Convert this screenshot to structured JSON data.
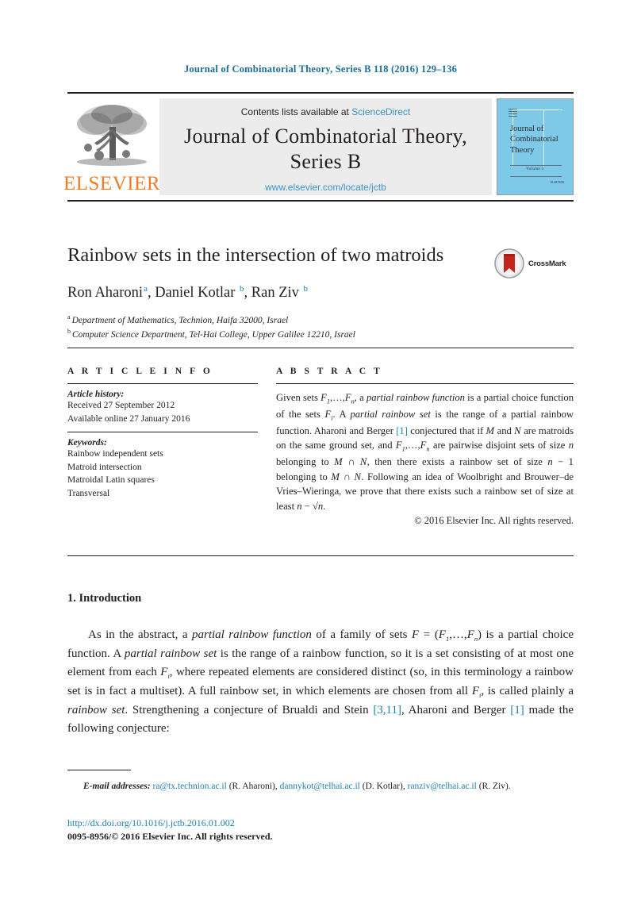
{
  "running_head": "Journal of Combinatorial Theory, Series B 118 (2016) 129–136",
  "masthead": {
    "publisher_logo_text": "ELSEVIER",
    "contents_prefix": "Contents lists available at",
    "contents_link": "ScienceDirect",
    "journal_title_line1": "Journal of Combinatorial Theory,",
    "journal_title_line2": "Series B",
    "journal_url": "www.elsevier.com/locate/jctb",
    "cover": {
      "title_line1": "Journal of",
      "title_line2": "Combinatorial",
      "title_line3": "Theory",
      "volume_text": "Volume 1",
      "footer_text": "ELSEVIER"
    }
  },
  "article": {
    "title": "Rainbow sets in the intersection of two matroids",
    "crossmark_label": "CrossMark",
    "authors_html": "Ron Aharoni<sup>a</sup>, Daniel Kotlar <sup>b</sup>, Ran Ziv <sup>b</sup>",
    "affiliations": [
      {
        "marker": "a",
        "text": "Department of Mathematics, Technion, Haifa 32000, Israel"
      },
      {
        "marker": "b",
        "text": "Computer Science Department, Tel-Hai College, Upper Galilee 12210, Israel"
      }
    ]
  },
  "info": {
    "section_label": "A R T I C L E   I N F O",
    "history_label": "Article history:",
    "history_lines": [
      "Received 27 September 2012",
      "Available online 27 January 2016"
    ],
    "keywords_label": "Keywords:",
    "keywords": [
      "Rainbow independent sets",
      "Matroid intersection",
      "Matroidal Latin squares",
      "Transversal"
    ]
  },
  "abstract": {
    "section_label": "A B S T R A C T",
    "text": "Given sets F1,…,Fn, a partial rainbow function is a partial choice function of the sets Fi. A partial rainbow set is the range of a partial rainbow function. Aharoni and Berger [1] conjectured that if M and N are matroids on the same ground set, and F1,…,Fn are pairwise disjoint sets of size n belonging to M ∩ N, then there exists a rainbow set of size n − 1 belonging to M ∩ N. Following an idea of Woolbright and Brouwer–de Vries–Wieringa, we prove that there exists such a rainbow set of size at least n − √n.",
    "copyright": "© 2016 Elsevier Inc. All rights reserved."
  },
  "introduction": {
    "heading": "1. Introduction",
    "paragraph": "As in the abstract, a partial rainbow function of a family of sets F = (F1,…,Fn) is a partial choice function. A partial rainbow set is the range of a rainbow function, so it is a set consisting of at most one element from each Fi, where repeated elements are considered distinct (so, in this terminology a rainbow set is in fact a multiset). A full rainbow set, in which elements are chosen from all Fi, is called plainly a rainbow set. Strengthening a conjecture of Brualdi and Stein [3,11], Aharoni and Berger [1] made the following conjecture:"
  },
  "footer": {
    "email_label": "E-mail addresses:",
    "emails": [
      {
        "address": "ra@tx.technion.ac.il",
        "person": "(R. Aharoni)"
      },
      {
        "address": "dannykot@telhai.ac.il",
        "person": "(D. Kotlar)"
      },
      {
        "address": "ranziv@telhai.ac.il",
        "person": "(R. Ziv)."
      }
    ],
    "doi": "http://dx.doi.org/10.1016/j.jctb.2016.01.002",
    "issn_line": "0095-8956/© 2016 Elsevier Inc. All rights reserved."
  },
  "colors": {
    "link_blue": "#1f7fb0",
    "header_blue": "#1a6e96",
    "elsevier_orange": "#ef7c24",
    "band_gray": "#ececec",
    "cover_blue": "#7ec8e8"
  }
}
